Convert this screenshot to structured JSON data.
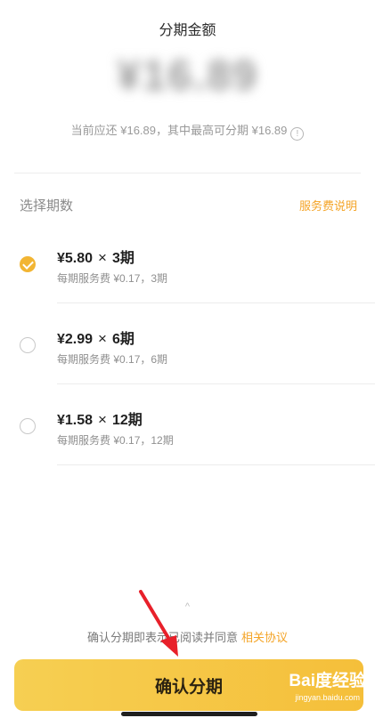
{
  "header": {
    "title": "分期金额",
    "amount": "¥16.89",
    "subtitle": "当前应还 ¥16.89，其中最高可分期 ¥16.89"
  },
  "section": {
    "label": "选择期数",
    "fee_link": "服务费说明"
  },
  "options": [
    {
      "amount": "¥5.80",
      "times": "×",
      "periods": "3期",
      "detail": "每期服务费 ¥0.17，3期",
      "selected": true
    },
    {
      "amount": "¥2.99",
      "times": "×",
      "periods": "6期",
      "detail": "每期服务费 ¥0.17，6期",
      "selected": false
    },
    {
      "amount": "¥1.58",
      "times": "×",
      "periods": "12期",
      "detail": "每期服务费 ¥0.17，12期",
      "selected": false
    }
  ],
  "footer": {
    "caret": "^",
    "agree_text": "确认分期即表示已阅读并同意",
    "agree_link": "相关协议",
    "confirm_button": "确认分期"
  },
  "watermark": {
    "main": "Bai度经验",
    "sub": "jingyan.baidu.com"
  },
  "colors": {
    "accent": "#f4a427",
    "button": "#f5c443",
    "annotation_arrow": "#e8202a"
  },
  "icons": {
    "info": "info-icon",
    "check": "check-icon"
  }
}
